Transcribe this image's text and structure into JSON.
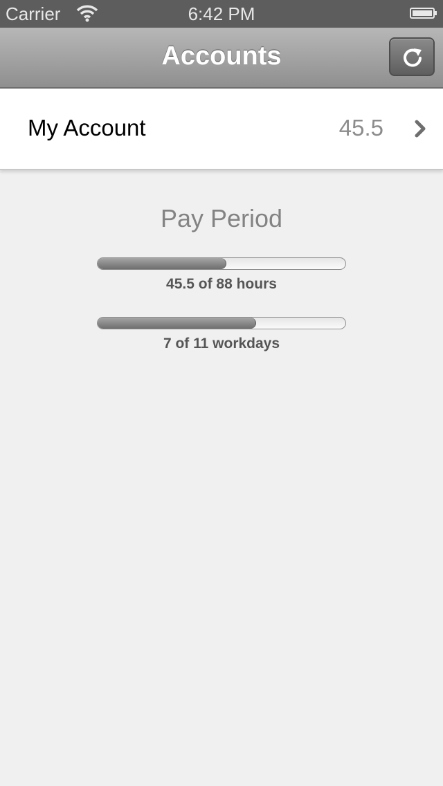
{
  "status_bar": {
    "carrier": "Carrier",
    "time": "6:42 PM",
    "wifi_icon": "wifi-icon",
    "battery_icon": "battery-icon"
  },
  "nav": {
    "title": "Accounts",
    "refresh_icon": "refresh-icon"
  },
  "account": {
    "name": "My Account",
    "value": "45.5",
    "chevron_icon": "chevron-right-icon"
  },
  "pay_period": {
    "title": "Pay Period",
    "hours": {
      "label": "45.5 of 88 hours",
      "fraction": 0.517
    },
    "workdays": {
      "label": "7 of 11 workdays",
      "fraction": 0.636
    }
  },
  "colors": {
    "nav_top": "#b7b7b7",
    "nav_bottom": "#8f8f8f",
    "status_bar": "#5d5d5d",
    "background": "#f0f0f0"
  }
}
